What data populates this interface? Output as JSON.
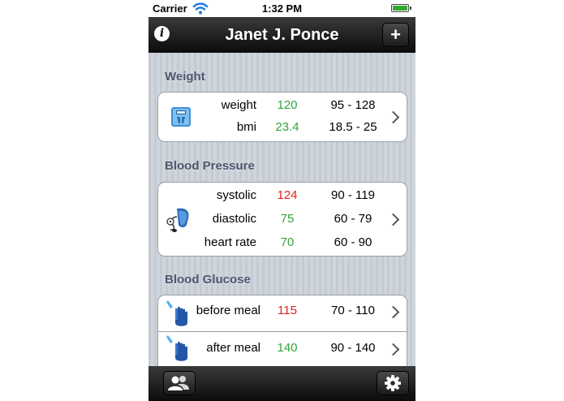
{
  "status_bar": {
    "carrier": "Carrier",
    "time": "1:32 PM"
  },
  "nav": {
    "title": "Janet J. Ponce",
    "info_label": "i",
    "add_label": "+"
  },
  "colors": {
    "good": "#2fa53a",
    "bad": "#e0211d",
    "section_title": "#4c566c"
  },
  "sections": {
    "weight": {
      "title": "Weight",
      "icon": "bathroom-scale-icon",
      "rows": [
        {
          "label": "weight",
          "value": "120",
          "range": "95 - 128",
          "status": "good"
        },
        {
          "label": "bmi",
          "value": "23.4",
          "range": "18.5 - 25",
          "status": "good"
        }
      ]
    },
    "blood_pressure": {
      "title": "Blood Pressure",
      "icon": "blood-pressure-cuff-icon",
      "rows": [
        {
          "label": "systolic",
          "value": "124",
          "range": "90 - 119",
          "status": "bad"
        },
        {
          "label": "diastolic",
          "value": "75",
          "range": "60 - 79",
          "status": "good"
        },
        {
          "label": "heart rate",
          "value": "70",
          "range": "60 - 90",
          "status": "good"
        }
      ]
    },
    "blood_glucose": {
      "title": "Blood Glucose",
      "icon": "finger-prick-icon",
      "rows": [
        {
          "label": "before meal",
          "value": "115",
          "range": "70 - 110",
          "status": "bad"
        },
        {
          "label": "after meal",
          "value": "140",
          "range": "90 - 140",
          "status": "good"
        }
      ]
    }
  },
  "tab_bar": {
    "left_icon": "contacts-icon",
    "right_icon": "settings-gear-icon"
  }
}
